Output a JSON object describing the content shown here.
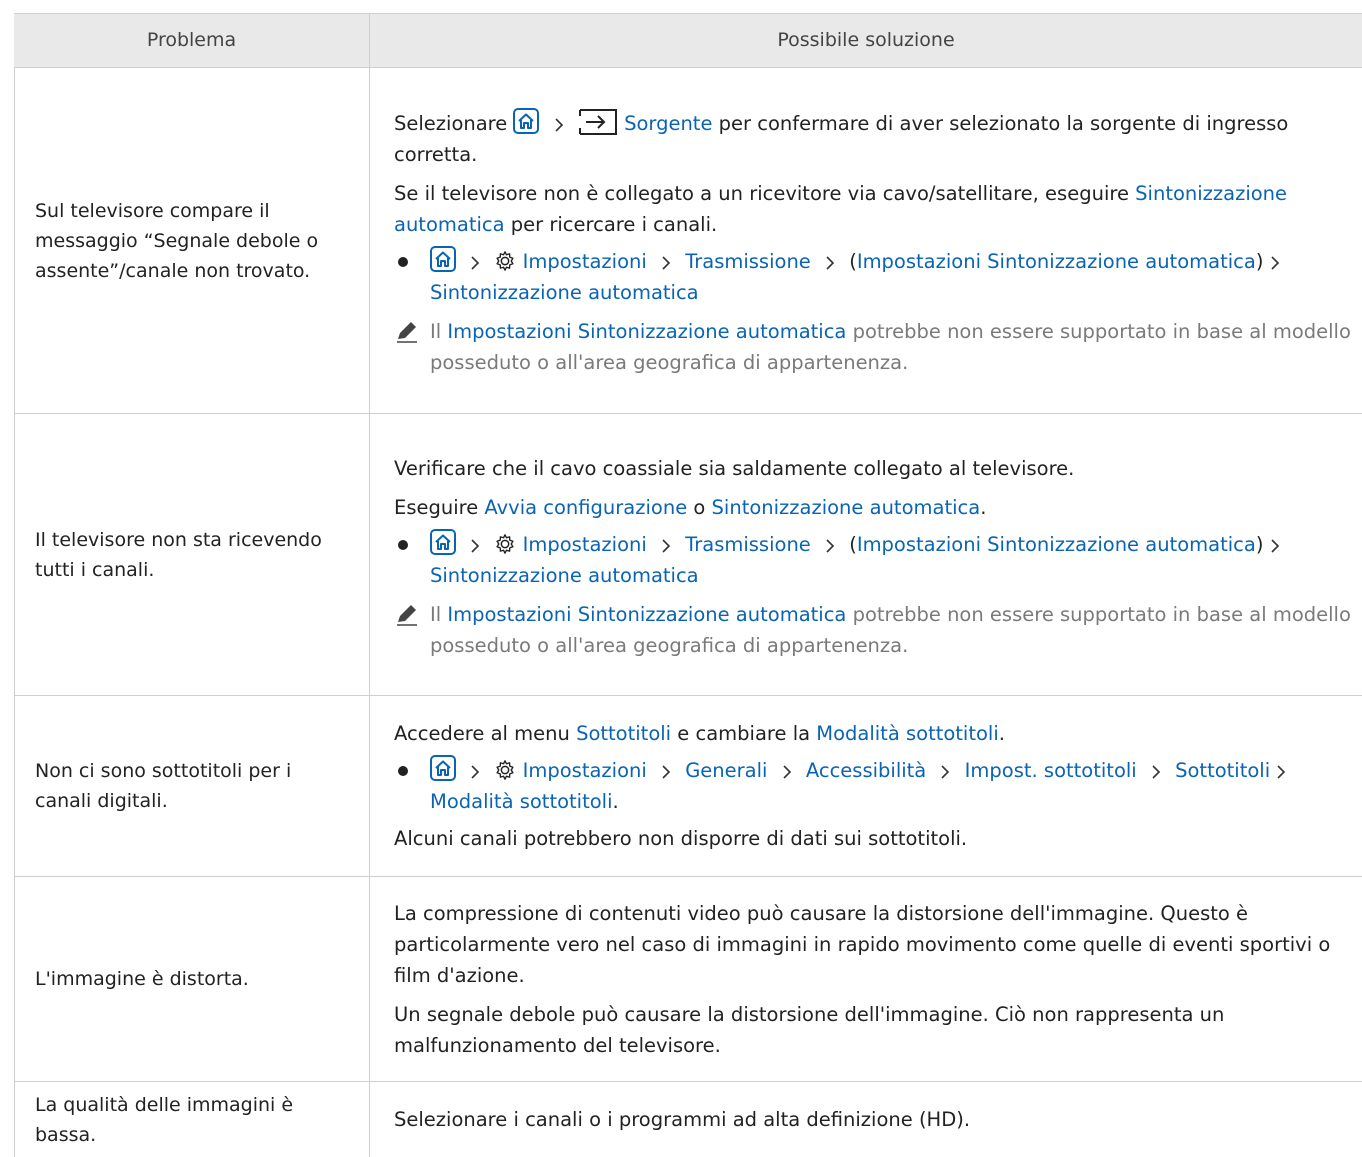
{
  "header": {
    "col_problem": "Problema",
    "col_solution": "Possibile soluzione"
  },
  "rows": [
    {
      "problem": "Sul televisore compare il messaggio “Segnale debole o assente”/canale non trovato.",
      "p1_a": "Selezionare",
      "p1_link": "Sorgente",
      "p1_b": "per confermare di aver selezionato la sorgente di ingresso corretta.",
      "p2_a": "Se il televisore non è collegato a un ricevitore via cavo/satellitare, eseguire",
      "p2_link": "Sintonizzazione automatica",
      "p2_b": "per ricercare i canali.",
      "path": [
        "Impostazioni",
        "Trasmissione",
        "(",
        "Impostazioni Sintonizzazione automatica",
        ")",
        "Sintonizzazione automatica"
      ],
      "note_a": "Il",
      "note_link": "Impostazioni Sintonizzazione automatica",
      "note_b": "potrebbe non essere supportato in base al modello posseduto o all'area geografica di appartenenza."
    },
    {
      "problem": "Il televisore non sta ricevendo tutti i canali.",
      "p1": "Verificare che il cavo coassiale sia saldamente collegato al televisore.",
      "p2_a": "Eseguire",
      "p2_link1": "Avvia configurazione",
      "p2_mid": "o",
      "p2_link2": "Sintonizzazione automatica",
      "p2_end": ".",
      "path": [
        "Impostazioni",
        "Trasmissione",
        "(",
        "Impostazioni Sintonizzazione automatica",
        ")",
        "Sintonizzazione automatica"
      ],
      "note_a": "Il",
      "note_link": "Impostazioni Sintonizzazione automatica",
      "note_b": "potrebbe non essere supportato in base al modello posseduto o all'area geografica di appartenenza."
    },
    {
      "problem": "Non ci sono sottotitoli per i canali digitali.",
      "p1_a": "Accedere al menu",
      "p1_link1": "Sottotitoli",
      "p1_mid": "e cambiare la",
      "p1_link2": "Modalità sottotitoli",
      "p1_end": ".",
      "path": [
        "Impostazioni",
        "Generali",
        "Accessibilità",
        "Impost. sottotitoli",
        "Sottotitoli",
        "Modalità sottotitoli"
      ],
      "path_end": ".",
      "p2": "Alcuni canali potrebbero non disporre di dati sui sottotitoli."
    },
    {
      "problem": "L'immagine è distorta.",
      "p1": "La compressione di contenuti video può causare la distorsione dell'immagine. Questo è particolarmente vero nel caso di immagini in rapido movimento come quelle di eventi sportivi o film d'azione.",
      "p2": "Un segnale debole può causare la distorsione dell'immagine. Ciò non rappresenta un malfunzionamento del televisore."
    },
    {
      "problem": "La qualità delle immagini è bassa.",
      "p1": "Selezionare i canali o i programmi ad alta definizione (HD)."
    }
  ],
  "icons": {
    "home": "home-icon",
    "source": "source-icon",
    "settings": "settings-gear-icon",
    "note": "pencil-note-icon",
    "chevron": "chevron-right-icon"
  },
  "colors": {
    "link": "#0b64b3",
    "header_bg": "#e9e9e9",
    "note_text": "#7a7a7a"
  }
}
